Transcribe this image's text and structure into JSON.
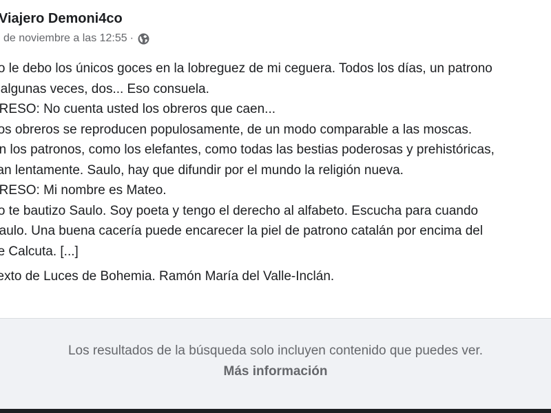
{
  "post": {
    "author": "Viajero Demoni4co",
    "timestamp": "de noviembre a las 12:55",
    "separator": "·",
    "privacy_icon": "globe-icon",
    "lines": [
      "Yo le debo los únicos goces en la lobreguez de mi ceguera. Todos los días, un patrono",
      "y algunas veces, dos... Eso consuela.",
      "PRESO: No cuenta usted los obreros que caen...",
      "Los obreros se reproducen populosamente, de un modo comparable a las moscas.",
      "En los patronos, como los elefantes, como todas las bestias poderosas y prehistóricas,",
      "van lentamente. Saulo, hay que difundir por el mundo la religión nueva.",
      "PRESO: Mi nombre es Mateo.",
      "Yo te bautizo Saulo. Soy poeta y tengo el derecho al alfabeto. Escucha para cuando",
      "Saulo. Una buena cacería puede encarecer la piel de patrono catalán por encima del",
      "de Calcuta. [...]"
    ],
    "source_line": "Texto de Luces de Bohemia. Ramón María del Valle-Inclán."
  },
  "footer": {
    "note": "Los resultados de la búsqueda solo incluyen contenido que puedes ver.",
    "more_link": "Más información"
  },
  "colors": {
    "text_primary": "#1c1e21",
    "text_secondary": "#65676b",
    "footer_bg": "#f0f2f5"
  }
}
